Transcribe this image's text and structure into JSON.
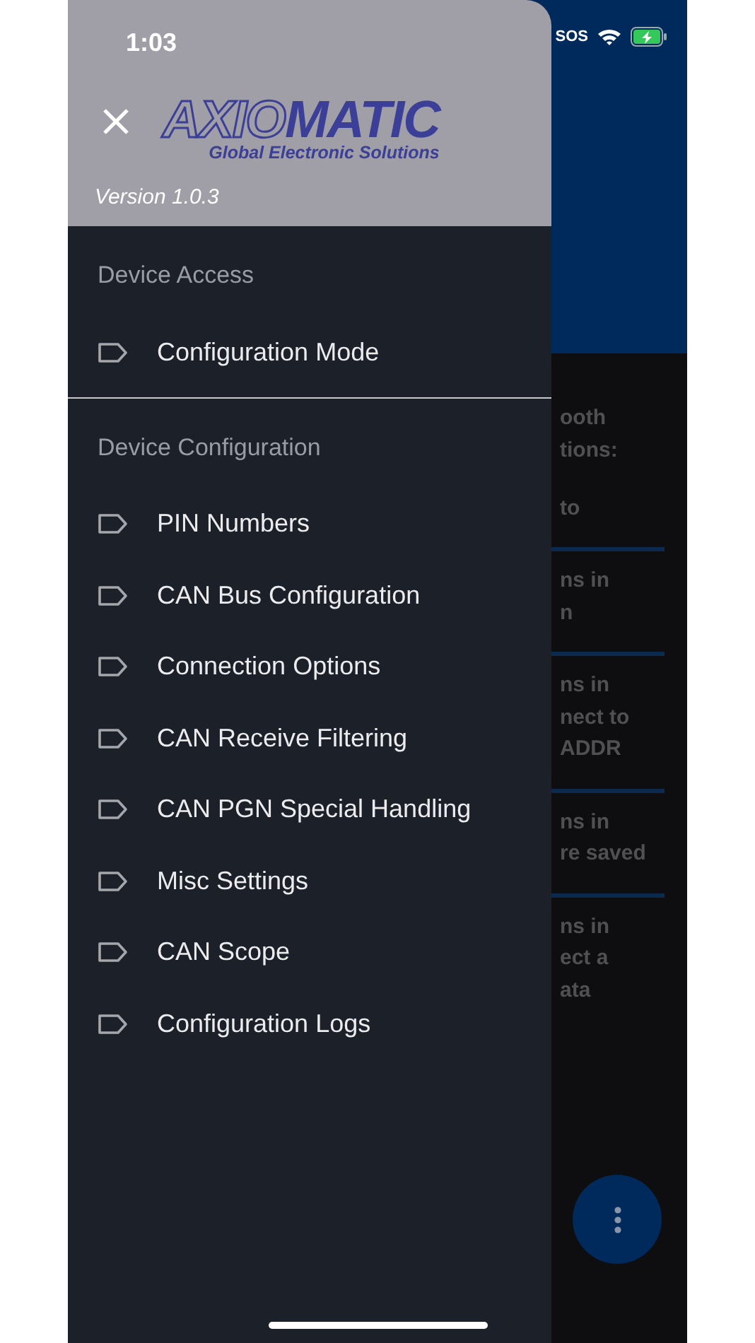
{
  "status_bar": {
    "time": "1:03",
    "sos": "SOS"
  },
  "drawer": {
    "logo": {
      "wordmark_left": "AXIO",
      "wordmark_right": "MATIC",
      "tagline": "Global Electronic Solutions"
    },
    "version": "Version 1.0.3",
    "sections": [
      {
        "title": "Device Access",
        "items": [
          {
            "label": "Configuration Mode"
          }
        ]
      },
      {
        "title": "Device Configuration",
        "items": [
          {
            "label": "PIN Numbers"
          },
          {
            "label": "CAN Bus Configuration"
          },
          {
            "label": "Connection Options"
          },
          {
            "label": "CAN Receive Filtering"
          },
          {
            "label": "CAN PGN Special Handling"
          },
          {
            "label": "Misc Settings"
          },
          {
            "label": "CAN Scope"
          },
          {
            "label": "Configuration Logs"
          }
        ]
      }
    ]
  },
  "background": {
    "cards": [
      {
        "paragraphs": [
          [
            "ooth",
            "tions:"
          ],
          [
            "to"
          ]
        ]
      },
      {
        "paragraphs": [
          [
            "ns in",
            "n"
          ]
        ]
      },
      {
        "paragraphs": [
          [
            "ns in",
            "nect to",
            "ADDR"
          ]
        ]
      },
      {
        "paragraphs": [
          [
            "ns in",
            "re saved"
          ]
        ]
      },
      {
        "paragraphs": [
          [
            "ns in",
            "ect a",
            "ata"
          ]
        ]
      }
    ]
  }
}
